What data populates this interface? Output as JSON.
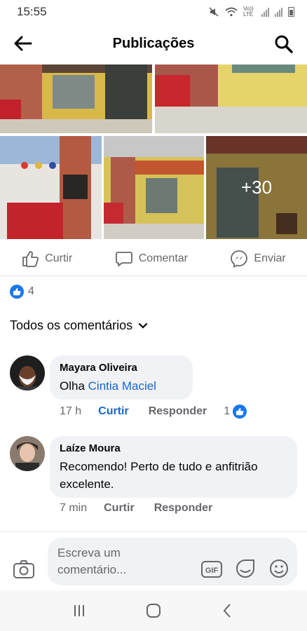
{
  "status": {
    "time": "15:55",
    "network": "Vo)) LTE"
  },
  "header": {
    "title": "Publicações"
  },
  "photos": {
    "more_label": "+30"
  },
  "actions": {
    "like": "Curtir",
    "comment": "Comentar",
    "send": "Enviar"
  },
  "reactions": {
    "count": "4"
  },
  "filter": {
    "label": "Todos os comentários"
  },
  "comments": [
    {
      "author": "Mayara Oliveira",
      "text_prefix": "Olha ",
      "mention": "Cintia Maciel",
      "time": "17 h",
      "like": "Curtir",
      "reply": "Responder",
      "likes": "1"
    },
    {
      "author": "Laíze Moura",
      "text": "Recomendo! Perto de tudo e anfitrião excelente.",
      "time": "7 min",
      "like": "Curtir",
      "reply": "Responder"
    }
  ],
  "composer": {
    "placeholder": "Escreva um comentário..."
  },
  "colors": {
    "accent": "#1877f2",
    "link": "#1a66c9",
    "bubble": "#f0f2f5",
    "muted": "#65676b"
  },
  "icons": [
    "back-arrow-icon",
    "search-icon",
    "thumbs-up-icon",
    "comment-icon",
    "messenger-icon",
    "camera-icon",
    "gif-icon",
    "sticker-icon",
    "emoji-icon"
  ]
}
